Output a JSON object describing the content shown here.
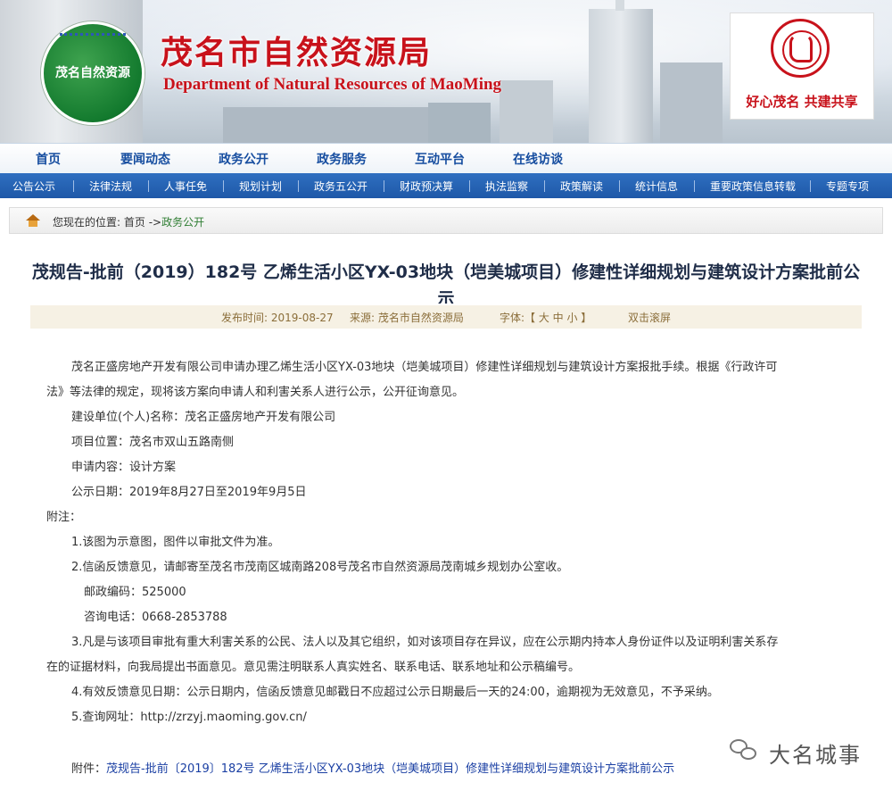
{
  "header": {
    "logo_text": "茂名自然资源",
    "title": "茂名市自然资源局",
    "subtitle": "Department of Natural Resources of MaoMing",
    "slogan": "好心茂名 共建共享"
  },
  "main_nav": [
    "首页",
    "要闻动态",
    "政务公开",
    "政务服务",
    "互动平台",
    "在线访谈"
  ],
  "sub_nav": [
    "公告公示",
    "法律法规",
    "人事任免",
    "规划计划",
    "政务五公开",
    "财政预决算",
    "执法监察",
    "政策解读",
    "统计信息",
    "重要政策信息转载",
    "专题专项"
  ],
  "breadcrumb": {
    "label": "您现在的位置: ",
    "home": "首页",
    "arrow": " ->",
    "current": "政务公开"
  },
  "article": {
    "title": "茂规告-批前（2019）182号 乙烯生活小区YX-03地块（垲美城项目）修建性详细规划与建筑设计方案批前公示",
    "meta": {
      "date": "发布时间:  2019-08-27",
      "source": "来源:  茂名市自然资源局",
      "font": "字体:【 大 中 小 】",
      "scroll": "双击滚屏"
    },
    "paragraphs": [
      "茂名正盛房地产开发有限公司申请办理乙烯生活小区YX-03地块（垲美城项目）修建性详细规划与建筑设计方案报批手续。根据《行政许可",
      "法》等法律的规定，现将该方案向申请人和利害关系人进行公示，公开征询意见。",
      "建设单位(个人)名称：茂名正盛房地产开发有限公司",
      "项目位置：茂名市双山五路南侧",
      "申请内容：设计方案",
      "公示日期：2019年8月27日至2019年9月5日",
      "附注：",
      "1.该图为示意图，图件以审批文件为准。",
      "2.信函反馈意见，请邮寄至茂名市茂南区城南路208号茂名市自然资源局茂南城乡规划办公室收。",
      "邮政编码：525000",
      "咨询电话：0668-2853788",
      "3.凡是与该项目审批有重大利害关系的公民、法人以及其它组织，如对该项目存在异议，应在公示期内持本人身份证件以及证明利害关系存",
      "在的证据材料，向我局提出书面意见。意见需注明联系人真实姓名、联系电话、联系地址和公示稿编号。",
      "4.有效反馈意见日期：公示日期内，信函反馈意见邮戳日不应超过公示日期最后一天的24:00，逾期视为无效意见，不予采纳。",
      "5.查询网址：http://zrzyj.maoming.gov.cn/"
    ],
    "attachment_label": "附件：",
    "attachment_link": "茂规告-批前〔2019〕182号 乙烯生活小区YX-03地块（垲美城项目）修建性详细规划与建筑设计方案批前公示"
  },
  "watermark": "大名城事"
}
